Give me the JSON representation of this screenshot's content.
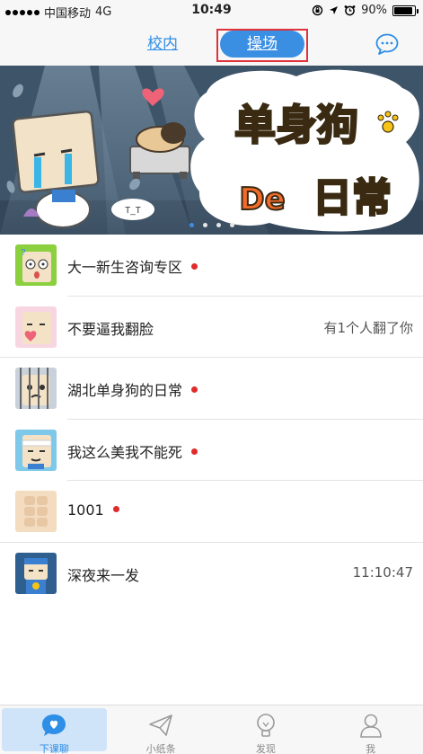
{
  "status_bar": {
    "carrier": "中国移动",
    "network": "4G",
    "time": "10:49",
    "battery_percent": "90%",
    "battery_level": 0.9
  },
  "nav": {
    "tabs": [
      {
        "label": "校内",
        "active": false
      },
      {
        "label": "操场",
        "active": true
      }
    ],
    "accent_color": "#3a8fe3",
    "highlight_color": "#e0323a"
  },
  "banner": {
    "title_part1": "单身狗",
    "title_part2_latin": "De",
    "title_part2": "日常",
    "emoticon": "T_T",
    "page_count": 4,
    "current_page": 1
  },
  "chats": [
    {
      "name": "大一新生咨询专区",
      "unread_dot": true,
      "meta": "",
      "avatar": "shocked-face-avatar"
    },
    {
      "name": "不要逼我翻脸",
      "unread_dot": false,
      "meta": "有1个人翻了你",
      "avatar": "heart-face-avatar"
    },
    {
      "name": "湖北单身狗的日常",
      "unread_dot": true,
      "meta": "",
      "avatar": "caged-face-avatar"
    },
    {
      "name": "我这么美我不能死",
      "unread_dot": true,
      "meta": "",
      "avatar": "bandaged-face-avatar"
    },
    {
      "name": "1001",
      "unread_dot": true,
      "meta": "",
      "avatar": "abs-avatar"
    },
    {
      "name": "深夜来一发",
      "unread_dot": false,
      "meta": "11:10:47",
      "avatar": "superhero-avatar"
    }
  ],
  "tab_bar": {
    "items": [
      {
        "label": "下课聊",
        "icon": "chat-heart-icon",
        "active": true
      },
      {
        "label": "小纸条",
        "icon": "paper-plane-icon",
        "active": false
      },
      {
        "label": "发现",
        "icon": "lightbulb-icon",
        "active": false
      },
      {
        "label": "我",
        "icon": "person-icon",
        "active": false
      }
    ]
  }
}
